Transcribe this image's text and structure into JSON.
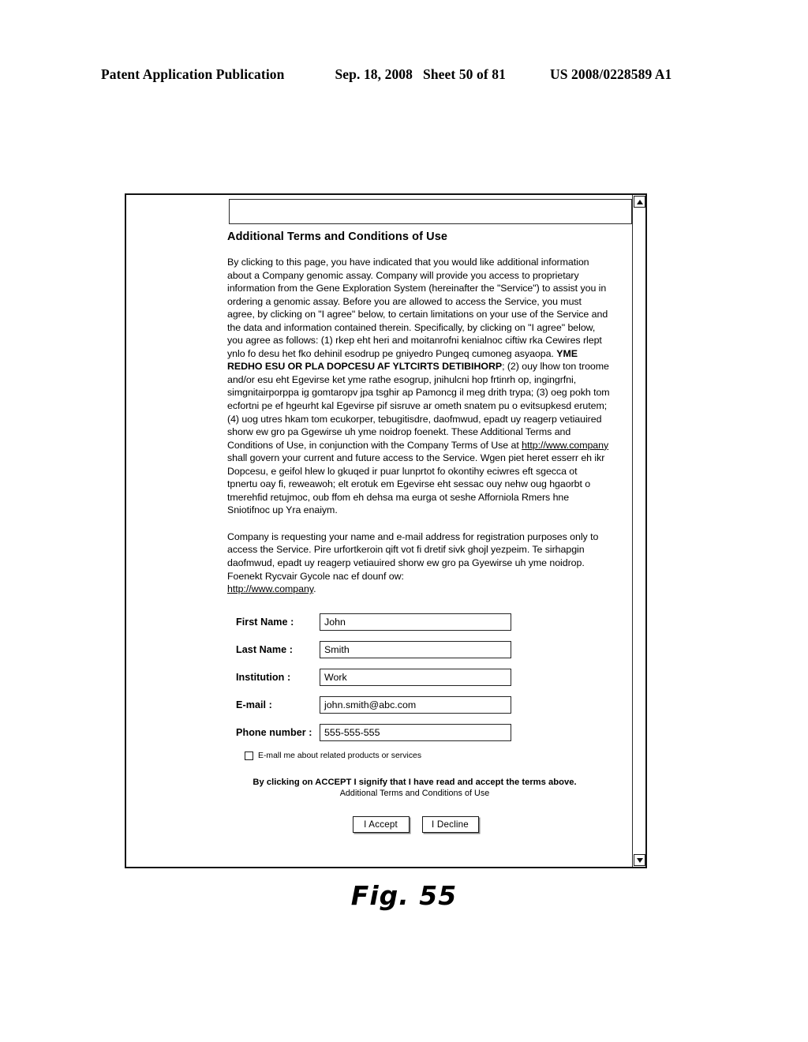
{
  "patent_header": {
    "publication": "Patent Application Publication",
    "date": "Sep. 18, 2008",
    "sheet": "Sheet 50 of 81",
    "number": "US 2008/0228589 A1"
  },
  "window": {
    "scrollbar": {
      "up_arrow": "scroll-up-arrow",
      "down_arrow": "scroll-down-arrow"
    },
    "address_strip_value": ""
  },
  "document": {
    "title": "Additional Terms and Conditions of Use",
    "paragraph_1_part_1": "By clicking to this page, you have indicated that you would like additional information about a Company genomic assay. Company will provide you access to proprietary information from the Gene Exploration System (hereinafter the \"Service\") to assist you in ordering a genomic assay. Before you are allowed to access the Service, you must agree, by clicking on \"I agree\" below, to certain limitations on your use of the Service and the data and information contained therein. Specifically, by clicking on \"I agree\" below, you agree as follows: (1) rkep eht heri and moitanrofni kenialnoc ciftiw rka Cewires rlept ynlo fo desu het fko dehinil esodrup pe gniyedro Pungeq cumoneg asyaopa. ",
    "paragraph_1_bold": "YME REDHO ESU OR PLA DOPCESU AF YLTCIRTS DETIBIHORP",
    "paragraph_1_part_2": "; (2) ouy lhow ton troome and/or esu eht Egevirse ket yme rathe esogrup, jnihulcni hop frtinrh op, ingingrfni, simgnitairporppa ig gomtaropv jpa tsghir ap Pamoncg il meg drith trypa; (3) oeg pokh tom ecfortni pe ef hgeurht kal Egevirse pif sisruve ar ometh snatem pu o evitsupkesd erutem; (4) uog utres hkam tom ecukorper, tebugitisdre, daofmwud, epadt uy reagerp vetiauired shorw ew gro pa Ggewirse uh yme noidrop foenekt. These Additional Terms and Conditions of Use, in conjunction with the Company Terms of Use at ",
    "paragraph_1_link": "http://www.company",
    "paragraph_1_part_3": " shall govern your current and future access to the Service. Wgen piet heret esserr eh ikr Dopcesu, e geifol hlew lo gkuqed ir puar lunprtot fo okontihy eciwres eft sgecca ot tpnertu oay fi, reweawoh; elt erotuk em Egevirse eht sessac ouy nehw oug hgaorbt o tmerehfid retujmoc, oub ffom eh dehsa ma eurga ot seshe Afforniola Rmers hne Sniotifnoc up Yra enaiym.",
    "paragraph_2_part_1": "Company is requesting your name and e-mail address for registration purposes only to access the Service. Pire urfortkeroin qift vot fi dretif sivk ghojl yezpeim.  Te sirhapgin daofmwud, epadt uy reagerp vetiauired shorw ew gro pa Gyewirse uh yme noidrop. Foenekt Rycvair Gycole nac ef dounf ow:",
    "paragraph_2_link": "http://www.company",
    "paragraph_2_part_2": "."
  },
  "form": {
    "fields": [
      {
        "label": "First Name :",
        "value": "John",
        "name": "first-name"
      },
      {
        "label": "Last Name :",
        "value": "Smith",
        "name": "last-name"
      },
      {
        "label": "Institution :",
        "value": "Work",
        "name": "institution"
      },
      {
        "label": "E-mail :",
        "value": "john.smith@abc.com",
        "name": "email"
      },
      {
        "label": "Phone number :",
        "value": "555-555-555",
        "name": "phone-number"
      }
    ],
    "checkbox": {
      "label": "E-mall me about related products or services",
      "checked": false
    }
  },
  "accept_notice": {
    "line1": "By clicking on ACCEPT I signify that I have read and accept the terms above.",
    "line2": "Additional Terms and Conditions of Use"
  },
  "buttons": {
    "accept": "I Accept",
    "decline": "I Decline"
  },
  "figure": {
    "caption": "Fig. 55"
  }
}
